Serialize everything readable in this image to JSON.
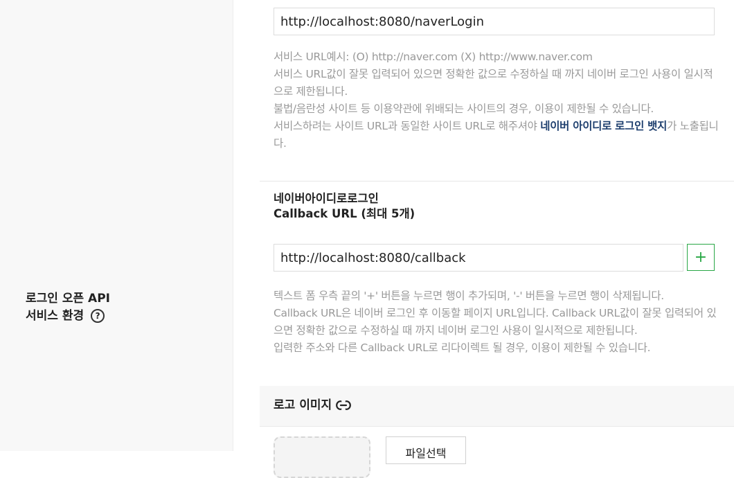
{
  "left": {
    "section_label_line1": "로그인 오픈 API",
    "section_label_line2": "서비스 환경",
    "help_icon_glyph": "?"
  },
  "service_url": {
    "value": "http://localhost:8080/naverLogin",
    "help": {
      "example": "서비스 URL예시: (O) http://naver.com (X) http://www.naver.com",
      "line2": "서비스 URL값이 잘못 입력되어 있으면 정확한 값으로 수정하실 때 까지 네이버 로그인 사용이 일시적으로 제한됩니다.",
      "line3": "불법/음란성 사이트 등 이용약관에 위배되는 사이트의 경우, 이용이 제한될 수 있습니다.",
      "line4_prefix": "서비스하려는 사이트 URL과 동일한 사이트 URL로 해주셔야 ",
      "line4_link": "네이버 아이디로 로그인 뱃지",
      "line4_suffix": "가 노출됩니다."
    }
  },
  "callback": {
    "heading_line1": "네이버아이디로로그인",
    "heading_line2": "Callback URL (최대 5개)",
    "value": "http://localhost:8080/callback",
    "add_button_label": "+",
    "help": {
      "line1": "텍스트 폼 우측 끝의 '+' 버튼을 누르면 행이 추가되며, '-' 버튼을 누르면 행이 삭제됩니다.",
      "line2": "Callback URL은 네이버 로그인 후 이동할 페이지 URL입니다. Callback URL값이 잘못 입력되어 있으면 정확한 값으로 수정하실 때 까지 네이버 로그인 사용이 일시적으로 제한됩니다.",
      "line3": "입력한 주소와 다른 Callback URL로 리다이렉트 될 경우, 이용이 제한될 수 있습니다."
    }
  },
  "logo": {
    "title": "로고 이미지",
    "file_button_label": "파일선택"
  },
  "colors": {
    "accent_green": "#28a745",
    "link_blue": "#1e3f6e",
    "help_gray": "#999999"
  }
}
